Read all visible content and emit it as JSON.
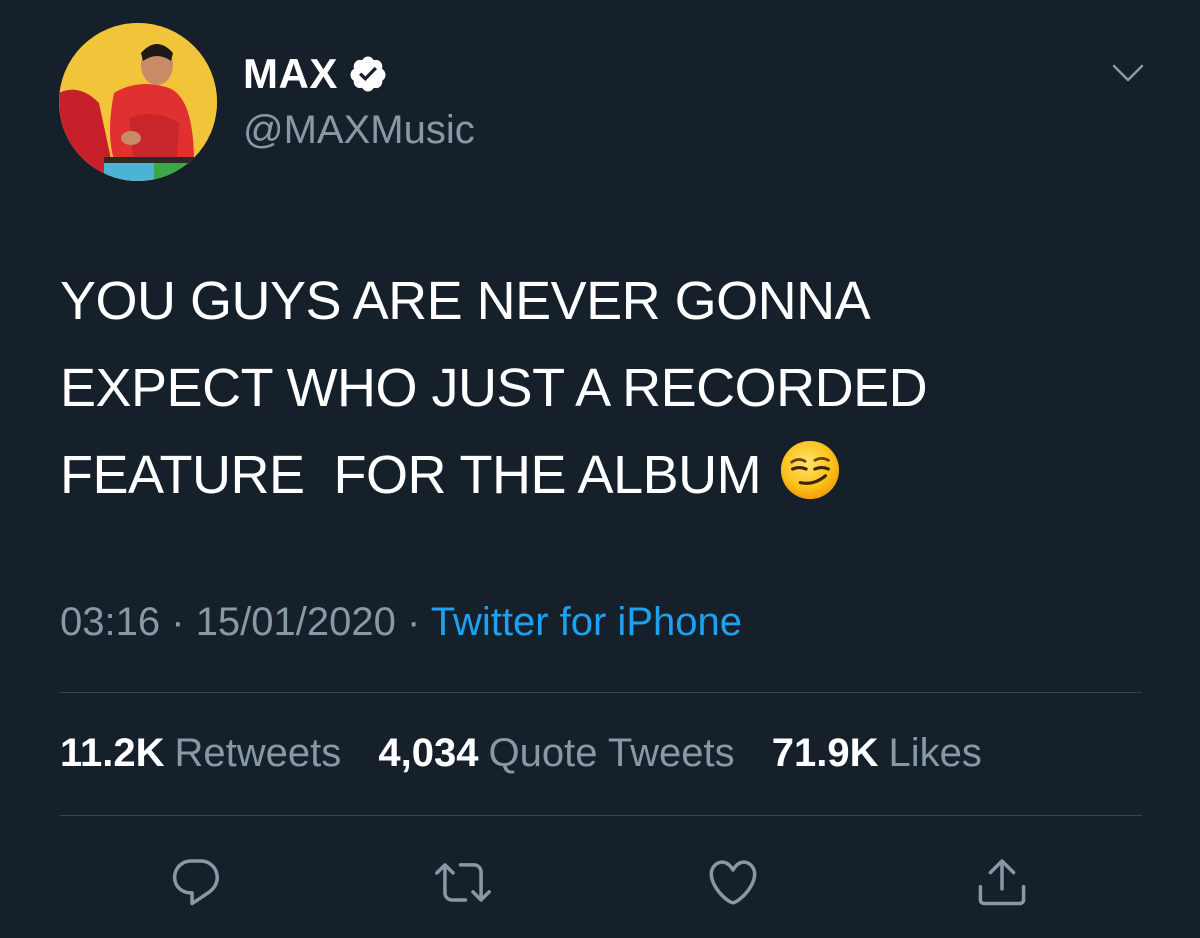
{
  "user": {
    "display_name": "MAX",
    "handle": "@MAXMusic",
    "verified": true
  },
  "tweet": {
    "lines": [
      "YOU GUYS ARE NEVER GONNA",
      "EXPECT WHO JUST A RECORDED",
      "FEATURE  FOR THE ALBUM"
    ],
    "emoji": "smirking-face-emoji",
    "time": "03:16",
    "date": "15/01/2020",
    "separator": "·",
    "source": "Twitter for iPhone"
  },
  "stats": {
    "retweets_count": "11.2K",
    "retweets_label": "Retweets",
    "quotes_count": "4,034",
    "quotes_label": "Quote Tweets",
    "likes_count": "71.9K",
    "likes_label": "Likes"
  },
  "actions": [
    "reply-icon",
    "retweet-icon",
    "like-icon",
    "share-icon"
  ],
  "colors": {
    "background": "#15202b",
    "text": "#ffffff",
    "secondary": "#8899a6",
    "link": "#1da1f2",
    "divider": "#38444d"
  }
}
